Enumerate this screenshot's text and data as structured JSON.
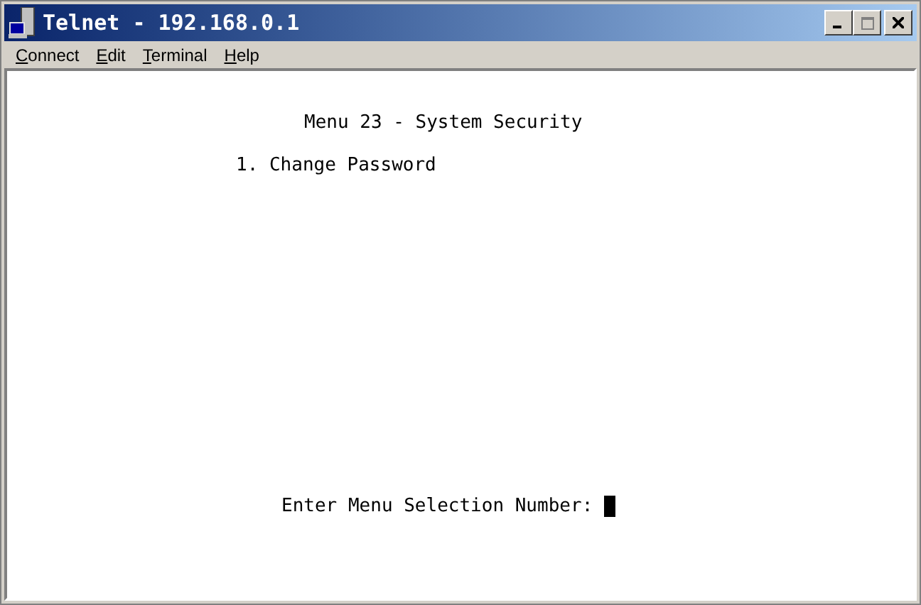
{
  "window": {
    "title": "Telnet - 192.168.0.1",
    "controls": [
      {
        "kind": "minimize",
        "disabled": false
      },
      {
        "kind": "maximize",
        "disabled": true
      },
      {
        "kind": "close",
        "disabled": false
      }
    ]
  },
  "menu": [
    {
      "label": "Connect"
    },
    {
      "label": "Edit"
    },
    {
      "label": "Terminal"
    },
    {
      "label": "Help"
    }
  ],
  "terminal": {
    "title": "Menu 23 - System Security",
    "items": [
      "1. Change Password"
    ],
    "prompt": "Enter Menu Selection Number:",
    "cursor": true
  }
}
